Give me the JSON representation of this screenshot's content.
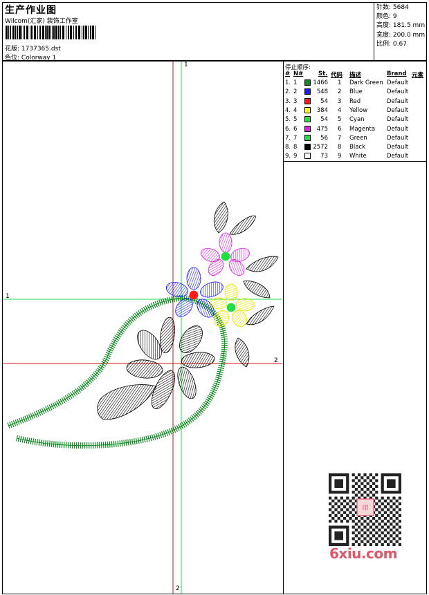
{
  "header": {
    "title": "生产作业图",
    "company": "Wilcom(汇家) 装饰工作室",
    "design_label": "花版:",
    "design_value": "1737365.dst",
    "colorway_label": "色位:",
    "colorway_value": "Colorway 1"
  },
  "stats": [
    {
      "label": "针数:",
      "value": "5684"
    },
    {
      "label": "颜色:",
      "value": "9"
    },
    {
      "label": "高度:",
      "value": "181.5 mm"
    },
    {
      "label": "宽度:",
      "value": "200.0 mm"
    },
    {
      "label": "比例:",
      "value": "0.67"
    }
  ],
  "stop_sequence": {
    "title": "停止顺序:",
    "columns": [
      "#",
      "N#",
      "St.",
      "代码",
      "描述",
      "Brand",
      "元素"
    ],
    "rows": [
      {
        "num": "1.",
        "n": "1",
        "st": "1466",
        "code": "1",
        "desc": "Dark Green",
        "brand": "Default",
        "color": "#0b8a1e"
      },
      {
        "num": "2.",
        "n": "2",
        "st": "548",
        "code": "2",
        "desc": "Blue",
        "brand": "Default",
        "color": "#1a1aff"
      },
      {
        "num": "3.",
        "n": "3",
        "st": "54",
        "code": "3",
        "desc": "Red",
        "brand": "Default",
        "color": "#ff1a1a"
      },
      {
        "num": "4.",
        "n": "4",
        "st": "384",
        "code": "4",
        "desc": "Yellow",
        "brand": "Default",
        "color": "#ffff00"
      },
      {
        "num": "5.",
        "n": "5",
        "st": "54",
        "code": "5",
        "desc": "Cyan",
        "brand": "Default",
        "color": "#22dd44"
      },
      {
        "num": "6.",
        "n": "6",
        "st": "475",
        "code": "6",
        "desc": "Magenta",
        "brand": "Default",
        "color": "#e020e0"
      },
      {
        "num": "7.",
        "n": "7",
        "st": "56",
        "code": "7",
        "desc": "Green",
        "brand": "Default",
        "color": "#22dd44"
      },
      {
        "num": "8.",
        "n": "8",
        "st": "2572",
        "code": "8",
        "desc": "Black",
        "brand": "Default",
        "color": "#000000"
      },
      {
        "num": "9.",
        "n": "9",
        "st": "73",
        "code": "9",
        "desc": "White",
        "brand": "Default",
        "color": "#ffffff"
      }
    ]
  },
  "axes": {
    "green_top": "1",
    "green_left": "1",
    "red_right": "2",
    "red_bottom": "2"
  },
  "watermark": "6xiu.com",
  "icons": {
    "qr": "qr-code-icon",
    "stamp": "red-seal-icon"
  }
}
